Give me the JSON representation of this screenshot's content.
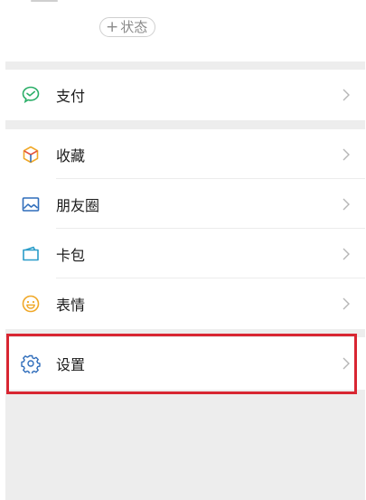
{
  "profile": {
    "status_plus": "+",
    "status_label": "状态"
  },
  "menu": {
    "pay": "支付",
    "favorites": "收藏",
    "moments": "朋友圈",
    "cards": "卡包",
    "stickers": "表情",
    "settings": "设置"
  },
  "colors": {
    "pay_icon": "#2aae67",
    "moments_icon": "#2f6dbb",
    "cards_icon": "#2a9dc9",
    "stickers_icon": "#f0a828",
    "settings_icon": "#2f6dbb",
    "highlight_border": "#d82632",
    "separator": "#ededed"
  },
  "icons": {
    "pay": "wallet-check-icon",
    "favorites": "cube-icon",
    "moments": "image-icon",
    "cards": "card-icon",
    "stickers": "smiley-icon",
    "settings": "gear-icon"
  }
}
